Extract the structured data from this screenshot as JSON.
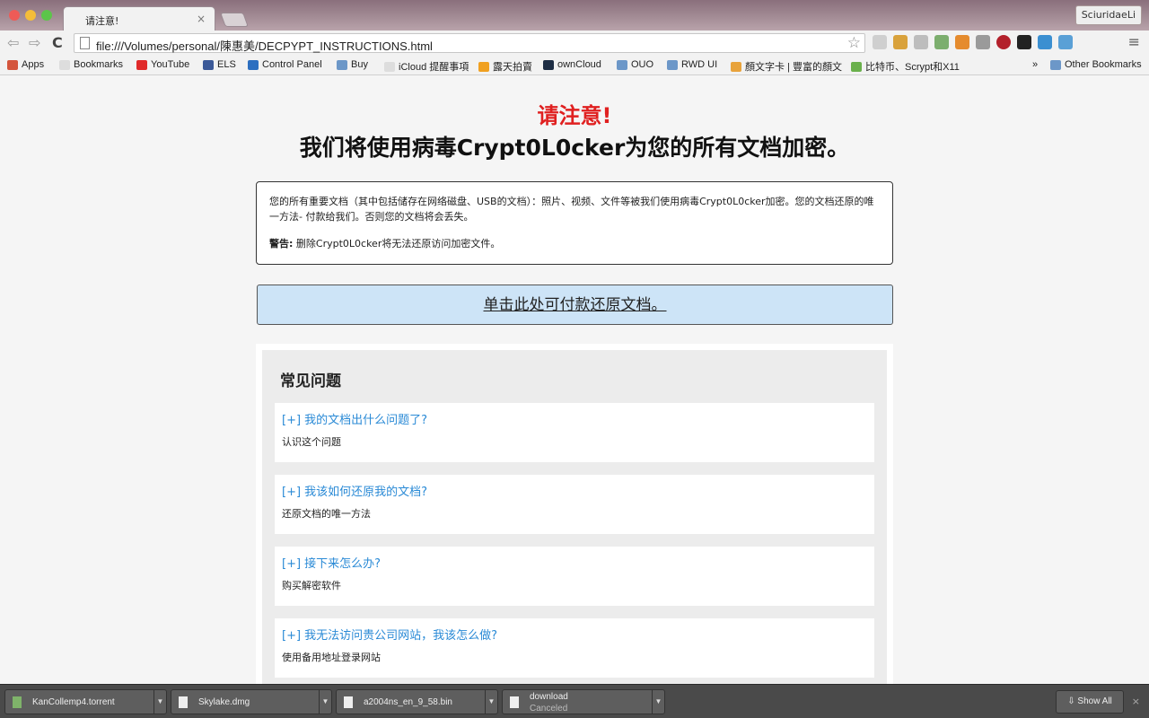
{
  "window": {
    "tab_title": "请注意!",
    "tab_close": "×",
    "profile": "SciuridaeLi"
  },
  "toolbar": {
    "back": "⇦",
    "forward": "⇨",
    "reload": "C",
    "url": "file:///Volumes/personal/陳惠美/DECPYPT_INSTRUCTIONS.html",
    "star": "☆",
    "menu": "≡"
  },
  "bookmarks": {
    "items": [
      "Apps",
      "Bookmarks",
      "YouTube",
      "ELS",
      "Control Panel",
      "Buy",
      "iCloud 提醒事項",
      "露天拍賣",
      "ownCloud",
      "OUO",
      "RWD UI",
      "顏文字卡 | 豐富的顏文",
      "比特币、Scrypt和X11"
    ],
    "overflow": "»",
    "other": "Other Bookmarks"
  },
  "page": {
    "alert": "请注意!",
    "headline": "我们将使用病毒Crypt0L0cker为您的所有文档加密。",
    "notice_text": "您的所有重要文档（其中包括储存在网络磁盘、USB的文档）：照片、视频、文件等被我们使用病毒Crypt0L0cker加密。您的文档还原的唯一方法- 付款给我们。否则您的文档将会丢失。",
    "warning_label": "警告:",
    "warning_text": " 删除Crypt0L0cker将无法还原访问加密文件。",
    "pay_link": "单击此处可付款还原文档。"
  },
  "faq": {
    "title": "常见问题",
    "items": [
      {
        "q": "[+] 我的文档出什么问题了?",
        "a": "认识这个问题"
      },
      {
        "q": "[+] 我该如何还原我的文档?",
        "a": "还原文档的唯一方法"
      },
      {
        "q": "[+] 接下来怎么办?",
        "a": "购买解密软件"
      },
      {
        "q": "[+] 我无法访问贵公司网站，我该怎么做?",
        "a": "使用备用地址登录网站"
      }
    ]
  },
  "downloads": {
    "items": [
      {
        "name": "KanCollemp4.torrent",
        "status": ""
      },
      {
        "name": "Skylake.dmg",
        "status": ""
      },
      {
        "name": "a2004ns_en_9_58.bin",
        "status": ""
      },
      {
        "name": "download",
        "status": "Canceled"
      }
    ],
    "show_all": "Show All",
    "close": "×"
  },
  "colors": {
    "alert_red": "#e02020",
    "link_blue": "#2a8ad6",
    "pay_bg": "#cde4f7"
  }
}
